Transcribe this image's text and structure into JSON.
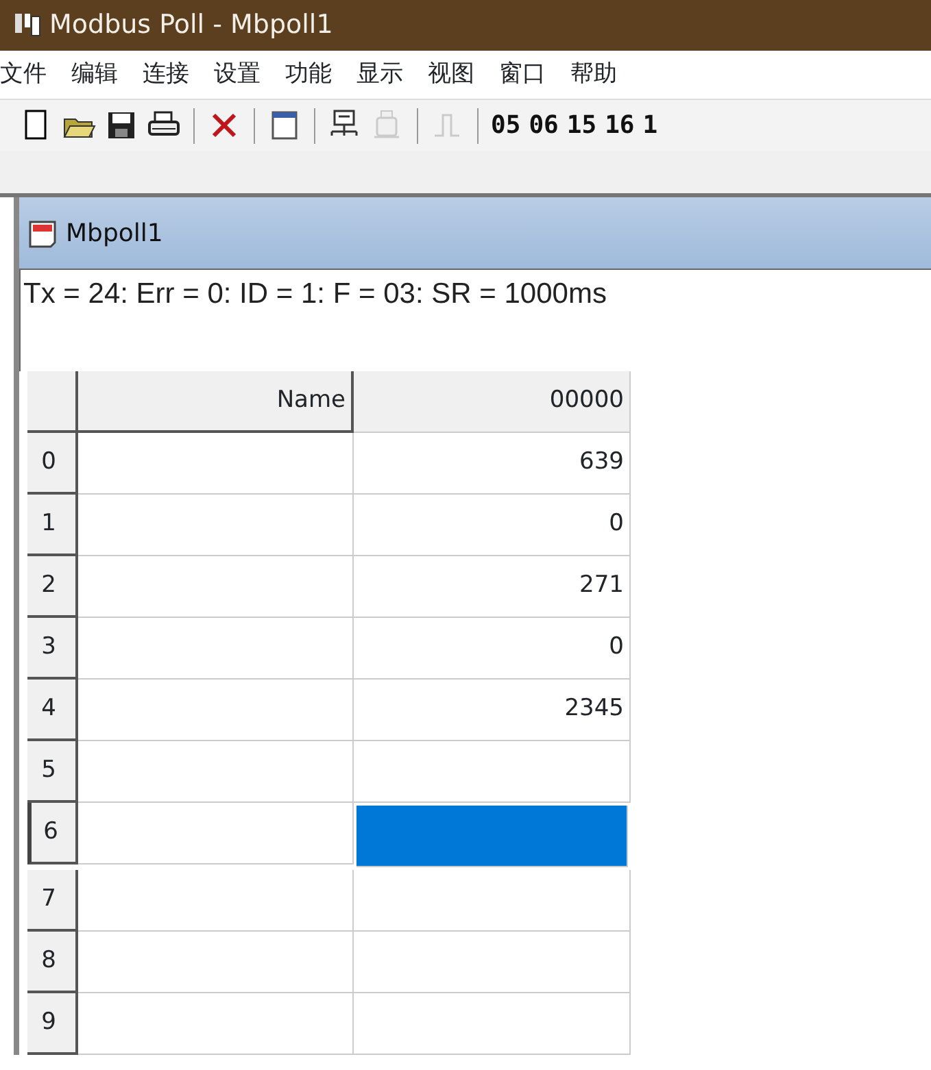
{
  "window": {
    "title": "Modbus Poll - Mbpoll1"
  },
  "menu": [
    "文件",
    "编辑",
    "连接",
    "设置",
    "功能",
    "显示",
    "视图",
    "窗口",
    "帮助"
  ],
  "toolbar": [
    {
      "kind": "new",
      "disabled": false
    },
    {
      "kind": "open",
      "disabled": false
    },
    {
      "kind": "save",
      "disabled": false
    },
    {
      "kind": "print",
      "disabled": false
    },
    {
      "kind": "sep"
    },
    {
      "kind": "delete",
      "disabled": false
    },
    {
      "kind": "sep"
    },
    {
      "kind": "window",
      "disabled": false
    },
    {
      "kind": "sep"
    },
    {
      "kind": "connect",
      "disabled": false
    },
    {
      "kind": "disconnect",
      "disabled": true
    },
    {
      "kind": "sep"
    },
    {
      "kind": "pulse",
      "disabled": true
    },
    {
      "kind": "sep"
    },
    {
      "kind": "code",
      "label": "05"
    },
    {
      "kind": "code",
      "label": "06"
    },
    {
      "kind": "code",
      "label": "15"
    },
    {
      "kind": "code",
      "label": "16"
    },
    {
      "kind": "code",
      "label": "1"
    }
  ],
  "document": {
    "title": "Mbpoll1",
    "status": "Tx = 24: Err = 0: ID = 1: F = 03: SR = 1000ms"
  },
  "table": {
    "columns": [
      "Name",
      "00000"
    ],
    "rows": [
      {
        "index": "0",
        "value": "639",
        "selected": false
      },
      {
        "index": "1",
        "value": "0",
        "selected": false
      },
      {
        "index": "2",
        "value": "271",
        "selected": false
      },
      {
        "index": "3",
        "value": "0",
        "selected": false
      },
      {
        "index": "4",
        "value": "2345",
        "selected": false
      },
      {
        "index": "5",
        "selected": false
      },
      {
        "index": "6",
        "selected": true
      },
      {
        "index": "7",
        "selected": false
      },
      {
        "index": "8",
        "selected": false
      },
      {
        "index": "9",
        "selected": false
      }
    ]
  }
}
